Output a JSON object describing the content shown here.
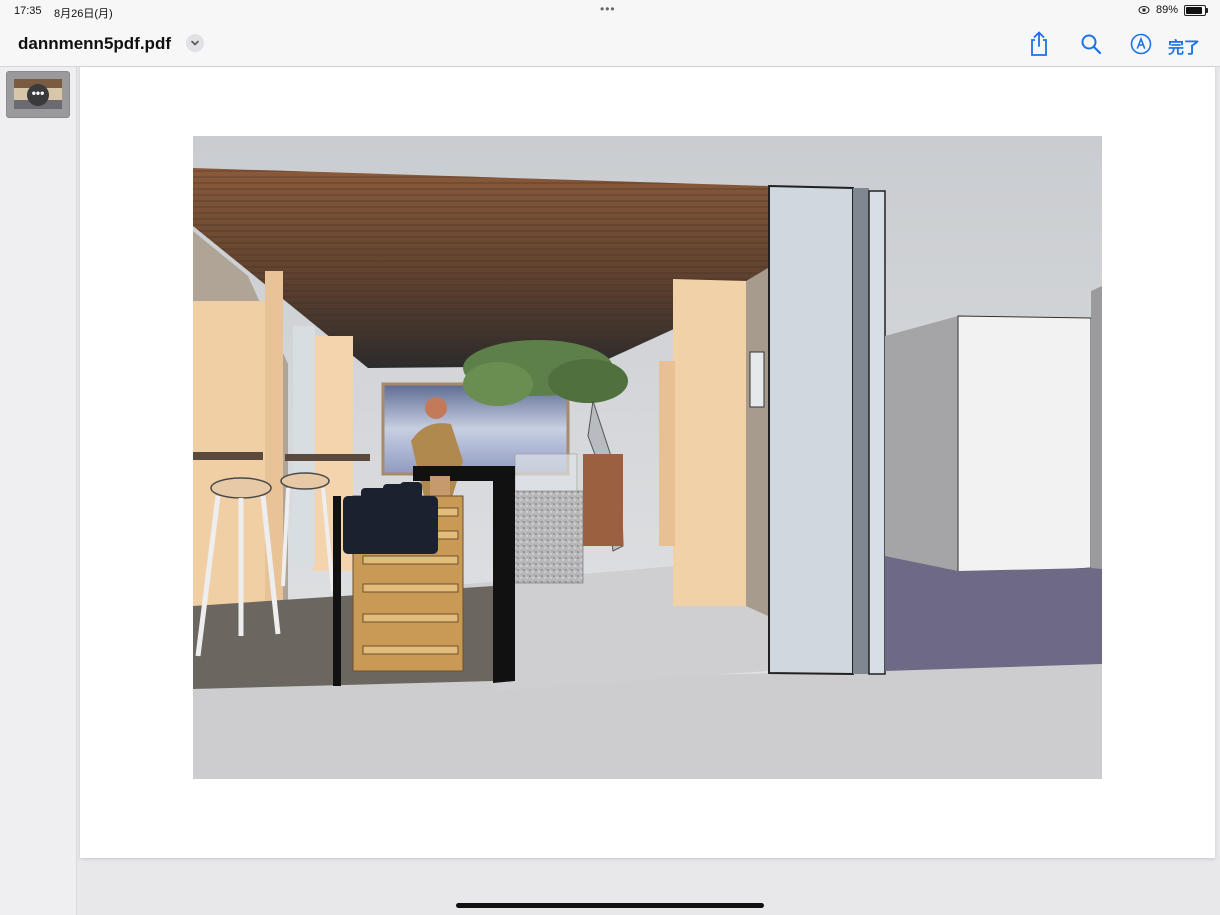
{
  "status_bar": {
    "time": "17:35",
    "date": "8月26日(月)",
    "battery_percent": "89%",
    "battery_level": 0.89
  },
  "nav_bar": {
    "title": "dannmenn5pdf.pdf",
    "done_label": "完了",
    "icons": [
      "share-icon",
      "search-icon",
      "markup-icon"
    ],
    "accent_color": "#1a73e8"
  },
  "sidebar": {
    "thumbnails": [
      {
        "page": 1,
        "selected": true
      }
    ]
  }
}
